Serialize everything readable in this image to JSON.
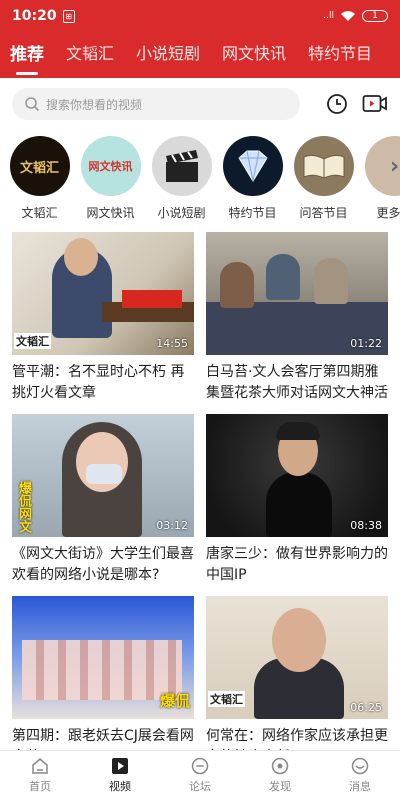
{
  "status": {
    "time": "10:20",
    "signal": "..ll",
    "battery": "1"
  },
  "tabs": [
    {
      "label": "推荐",
      "active": true
    },
    {
      "label": "文韬汇"
    },
    {
      "label": "小说短剧"
    },
    {
      "label": "网文快讯"
    },
    {
      "label": "特约节目"
    }
  ],
  "search": {
    "placeholder": "搜索你想看的视频"
  },
  "channels": [
    {
      "label": "文韬汇",
      "art": "文韬汇"
    },
    {
      "label": "网文快讯",
      "art": "网文快讯"
    },
    {
      "label": "小说短剧",
      "art": ""
    },
    {
      "label": "特约节目",
      "art": ""
    },
    {
      "label": "问答节目",
      "art": ""
    },
    {
      "label": "更多专",
      "art": ""
    }
  ],
  "videos": [
    {
      "title": "管平潮：名不显时心不朽 再挑灯火看文章",
      "duration": "14:55",
      "watermark": "文韬汇"
    },
    {
      "title": "白马苔·文人会客厅第四期雅集暨花茶大师对话网文大神活动",
      "duration": "01:22",
      "watermark": ""
    },
    {
      "title": "《网文大街访》大学生们最喜欢看的网络小说是哪本?",
      "duration": "03:12",
      "watermark": "爆侃网文"
    },
    {
      "title": "唐家三少：做有世界影响力的中国IP",
      "duration": "08:38",
      "watermark": ""
    },
    {
      "title": "第四期：跟老妖去CJ展会看网文节目",
      "duration": "",
      "watermark": "爆侃"
    },
    {
      "title": "何常在：网络作家应该承担更多的社会责任",
      "duration": "06:25",
      "watermark": "文韬汇"
    }
  ],
  "nav": [
    {
      "label": "首页"
    },
    {
      "label": "视频",
      "active": true
    },
    {
      "label": "论坛"
    },
    {
      "label": "发现"
    },
    {
      "label": "消息"
    }
  ]
}
